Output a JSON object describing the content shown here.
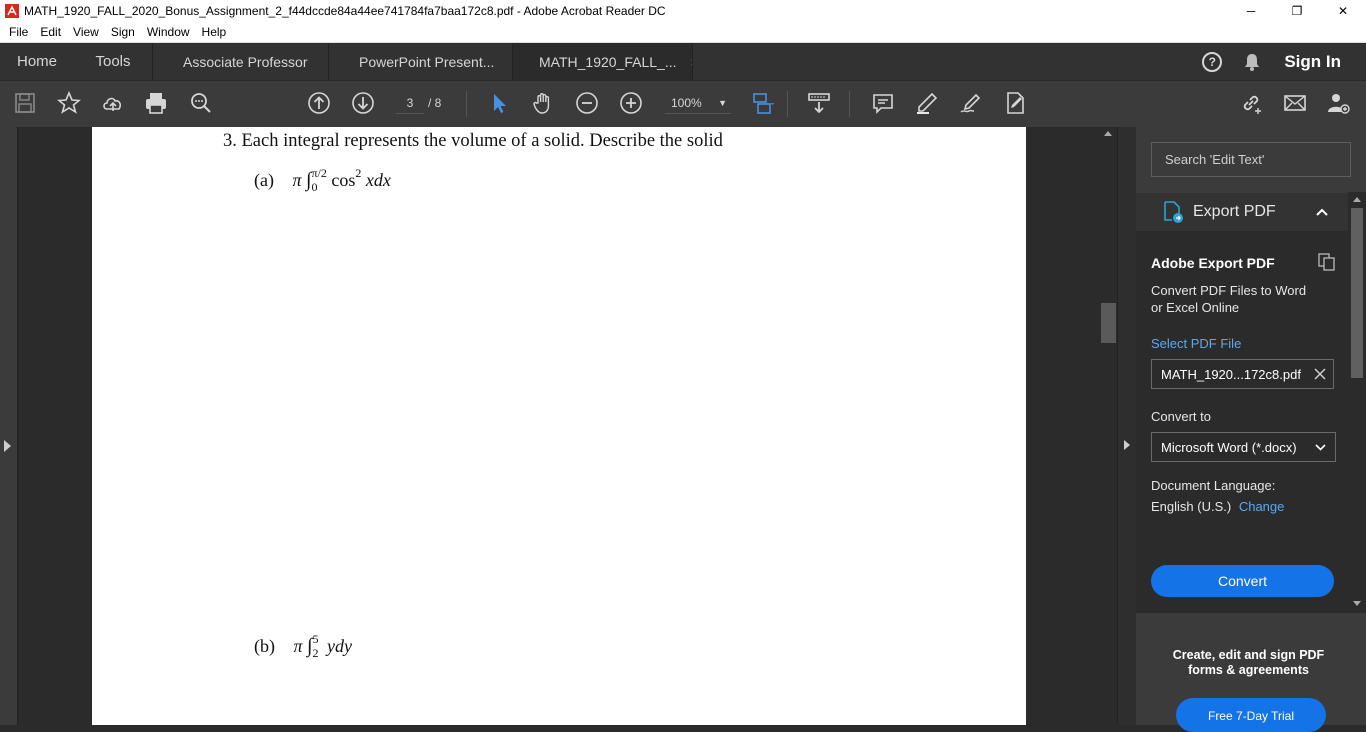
{
  "window": {
    "title": "MATH_1920_FALL_2020_Bonus_Assignment_2_f44dccde84a44ee741784fa7baa172c8.pdf - Adobe Acrobat Reader DC",
    "minimize": "─",
    "restore": "❐",
    "close": "✕"
  },
  "menu": [
    "File",
    "Edit",
    "View",
    "Sign",
    "Window",
    "Help"
  ],
  "tabs": {
    "home": "Home",
    "tools": "Tools",
    "docs": [
      {
        "label": "Associate Professor"
      },
      {
        "label": "PowerPoint Present..."
      },
      {
        "label": "MATH_1920_FALL_...",
        "close": "×"
      }
    ],
    "help": "?",
    "signin": "Sign In"
  },
  "toolbar": {
    "page_current": "3",
    "page_total": "/ 8",
    "zoom": "100%"
  },
  "document": {
    "question": "3.  Each integral represents the volume of a solid.  Describe the solid",
    "part_a": {
      "label": "(a)",
      "pi": "π",
      "int": "∫",
      "upper": "π/2",
      "lower": "0",
      "body": "cos",
      "exp": "2",
      "var": "xdx"
    },
    "part_b": {
      "label": "(b)",
      "pi": "π",
      "int": "∫",
      "upper": "5",
      "lower": "2",
      "var": "ydy"
    }
  },
  "rightpane": {
    "search_placeholder": "Search 'Edit Text'",
    "export_title": "Export PDF",
    "ae_title": "Adobe Export PDF",
    "ae_desc": "Convert PDF Files to Word or Excel Online",
    "select_label": "Select PDF File",
    "file_name": "MATH_1920...172c8.pdf",
    "convert_to_label": "Convert to",
    "format": "Microsoft Word (*.docx)",
    "lang_label": "Document Language:",
    "lang_value": "English (U.S.)",
    "lang_change": "Change",
    "convert_btn": "Convert",
    "promo": "Create, edit and sign PDF forms & agreements",
    "trial_btn": "Free 7-Day Trial"
  },
  "colors": {
    "accent_blue": "#1473e6",
    "link_blue": "#5aa9f0",
    "dark_bg": "#2b2b2b",
    "toolbar_bg": "#3b3b3b"
  }
}
